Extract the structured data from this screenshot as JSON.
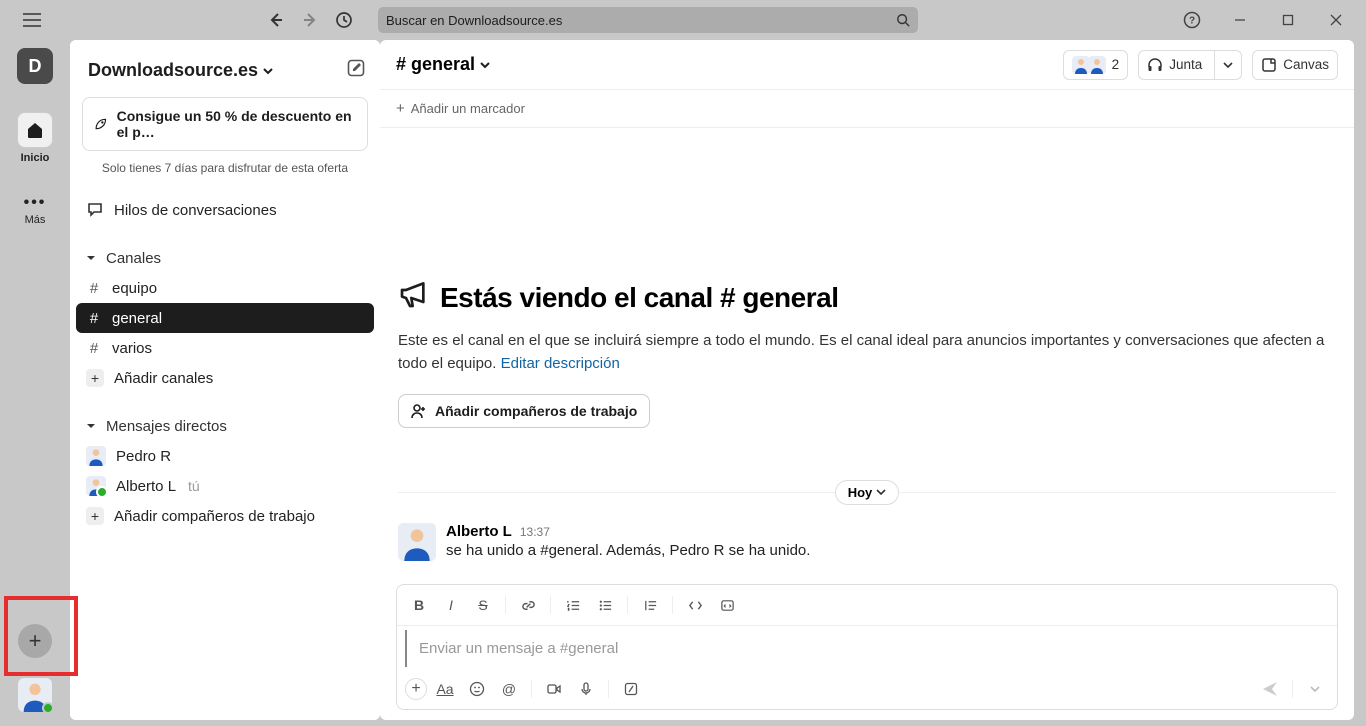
{
  "titlebar": {
    "search_placeholder": "Buscar en Downloadsource.es"
  },
  "rail": {
    "workspace_initial": "D",
    "home_label": "Inicio",
    "more_label": "Más"
  },
  "sidebar": {
    "workspace_name": "Downloadsource.es",
    "promo_text": "Consigue un 50 % de descuento en el p…",
    "promo_subtext": "Solo tienes 7 días para disfrutar de esta oferta",
    "threads_label": "Hilos de conversaciones",
    "channels_section": "Canales",
    "channels": [
      {
        "name": "equipo",
        "active": false
      },
      {
        "name": "general",
        "active": true
      },
      {
        "name": "varios",
        "active": false
      }
    ],
    "add_channels": "Añadir canales",
    "dm_section": "Mensajes directos",
    "dms": [
      {
        "name": "Pedro R",
        "you": false
      },
      {
        "name": "Alberto L",
        "you": true
      }
    ],
    "you_label": "tú",
    "add_coworkers": "Añadir compañeros de trabajo"
  },
  "channel": {
    "header_name": "# general",
    "member_count": "2",
    "huddle_label": "Junta",
    "canvas_label": "Canvas",
    "add_bookmark": "Añadir un marcador",
    "viewing_prefix": "Estás viendo el canal",
    "viewing_channel": "# general",
    "description_text": "Este es el canal en el que se incluirá siempre a todo el mundo. Es el canal ideal para anuncios importantes y conversaciones que afecten a todo el equipo. ",
    "edit_description": "Editar descripción",
    "add_coworkers_btn": "Añadir compañeros de trabajo",
    "date_label": "Hoy",
    "message": {
      "author": "Alberto L",
      "time": "13:37",
      "text": "se ha unido a #general. Además, Pedro R se ha unido."
    },
    "composer_placeholder": "Enviar un mensaje a #general"
  }
}
